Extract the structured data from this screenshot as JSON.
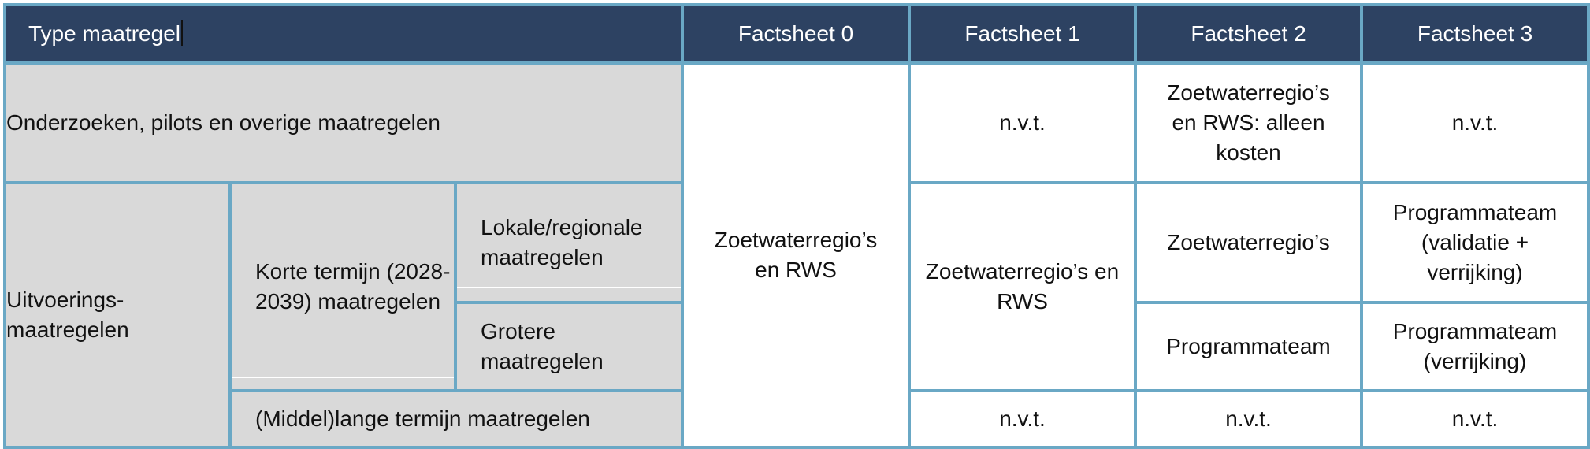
{
  "header": {
    "type_label": "Type maatregel",
    "factsheet_0": "Factsheet 0",
    "factsheet_1": "Factsheet 1",
    "factsheet_2": "Factsheet 2",
    "factsheet_3": "Factsheet 3"
  },
  "rows": {
    "onderzoeken": {
      "label": "Onderzoeken, pilots en overige maatregelen",
      "factsheet_1": "n.v.t.",
      "factsheet_2": "Zoetwaterregio’s en RWS: alleen kosten",
      "factsheet_3": "n.v.t."
    },
    "uitvoerings": {
      "label": "Uitvoerings-maatregelen"
    },
    "korte_termijn": {
      "label": "Korte termijn (2028-2039) maatregelen"
    },
    "lokale": {
      "label": "Lokale/regionale maatregelen",
      "factsheet_2": "Zoetwaterregio’s",
      "factsheet_3": "Programmateam (validatie + verrijking)"
    },
    "grotere": {
      "label": "Grotere maatregelen",
      "factsheet_2": "Programmateam",
      "factsheet_3": "Programmateam (verrijking)"
    },
    "middellange": {
      "label": "(Middel)lange termijn maatregelen",
      "factsheet_1": "n.v.t.",
      "factsheet_2": "n.v.t.",
      "factsheet_3": "n.v.t."
    },
    "factsheet_0_all": "Zoetwaterregio’s en RWS",
    "factsheet_1_uitvoering": "Zoetwaterregio’s en RWS"
  },
  "colors": {
    "header_bg": "#2d4262",
    "border": "#6aa8c5",
    "label_bg": "#d9d9d9"
  }
}
